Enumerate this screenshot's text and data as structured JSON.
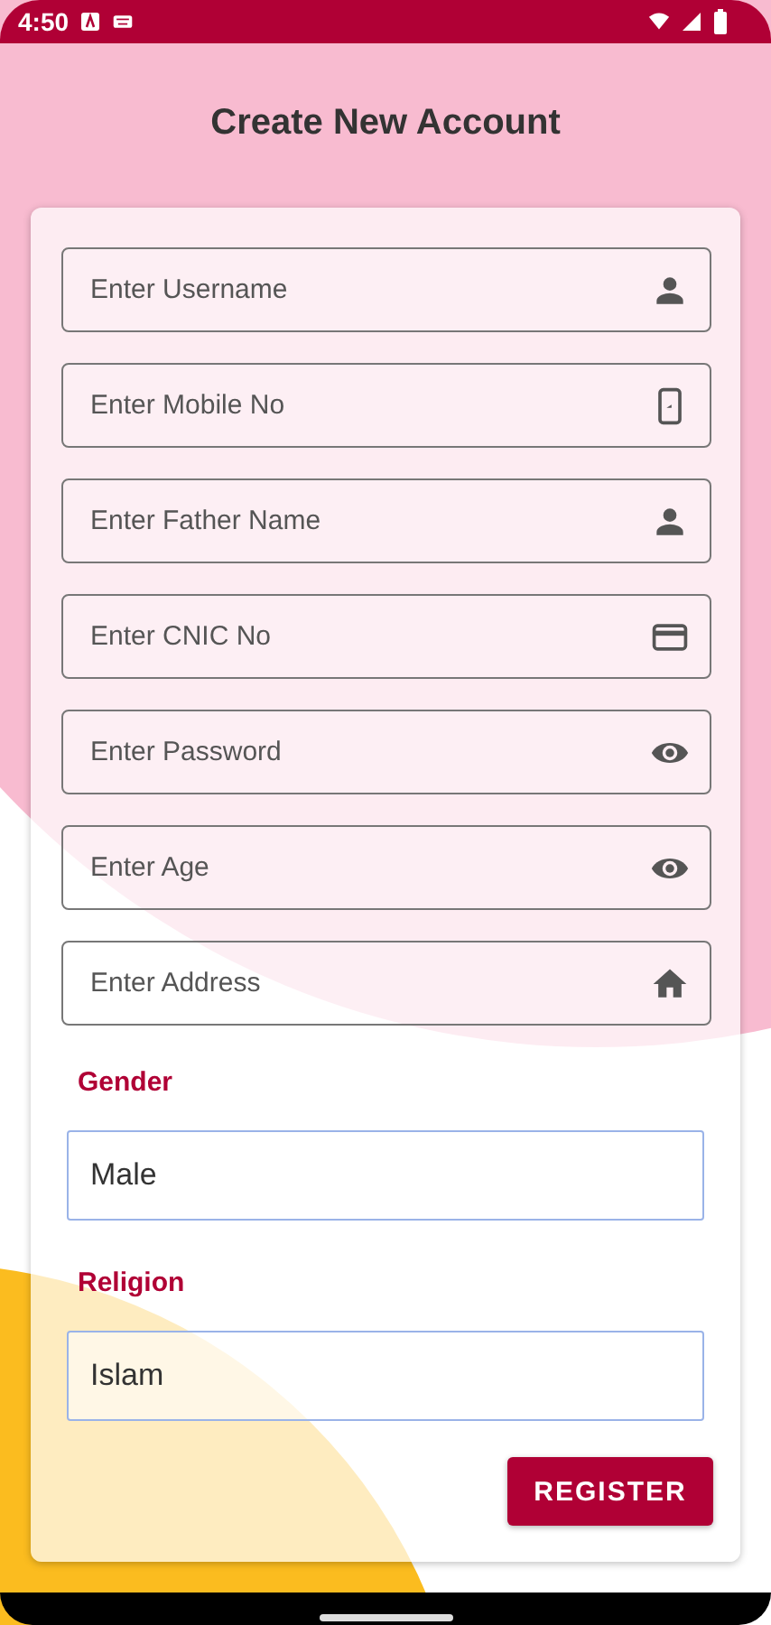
{
  "status_bar": {
    "time": "4:50"
  },
  "title": "Create New Account",
  "fields": [
    {
      "placeholder": "Enter Username",
      "kind": "person"
    },
    {
      "placeholder": "Enter Mobile No",
      "kind": "phone"
    },
    {
      "placeholder": "Enter Father Name",
      "kind": "person"
    },
    {
      "placeholder": "Enter CNIC No",
      "kind": "card"
    },
    {
      "placeholder": "Enter Password",
      "kind": "eye"
    },
    {
      "placeholder": "Enter Age",
      "kind": "eye"
    },
    {
      "placeholder": "Enter Address",
      "kind": "home"
    }
  ],
  "selects": [
    {
      "label": "Gender",
      "value": "Male"
    },
    {
      "label": "Religion",
      "value": "Islam"
    }
  ],
  "register_button": "REGISTER"
}
